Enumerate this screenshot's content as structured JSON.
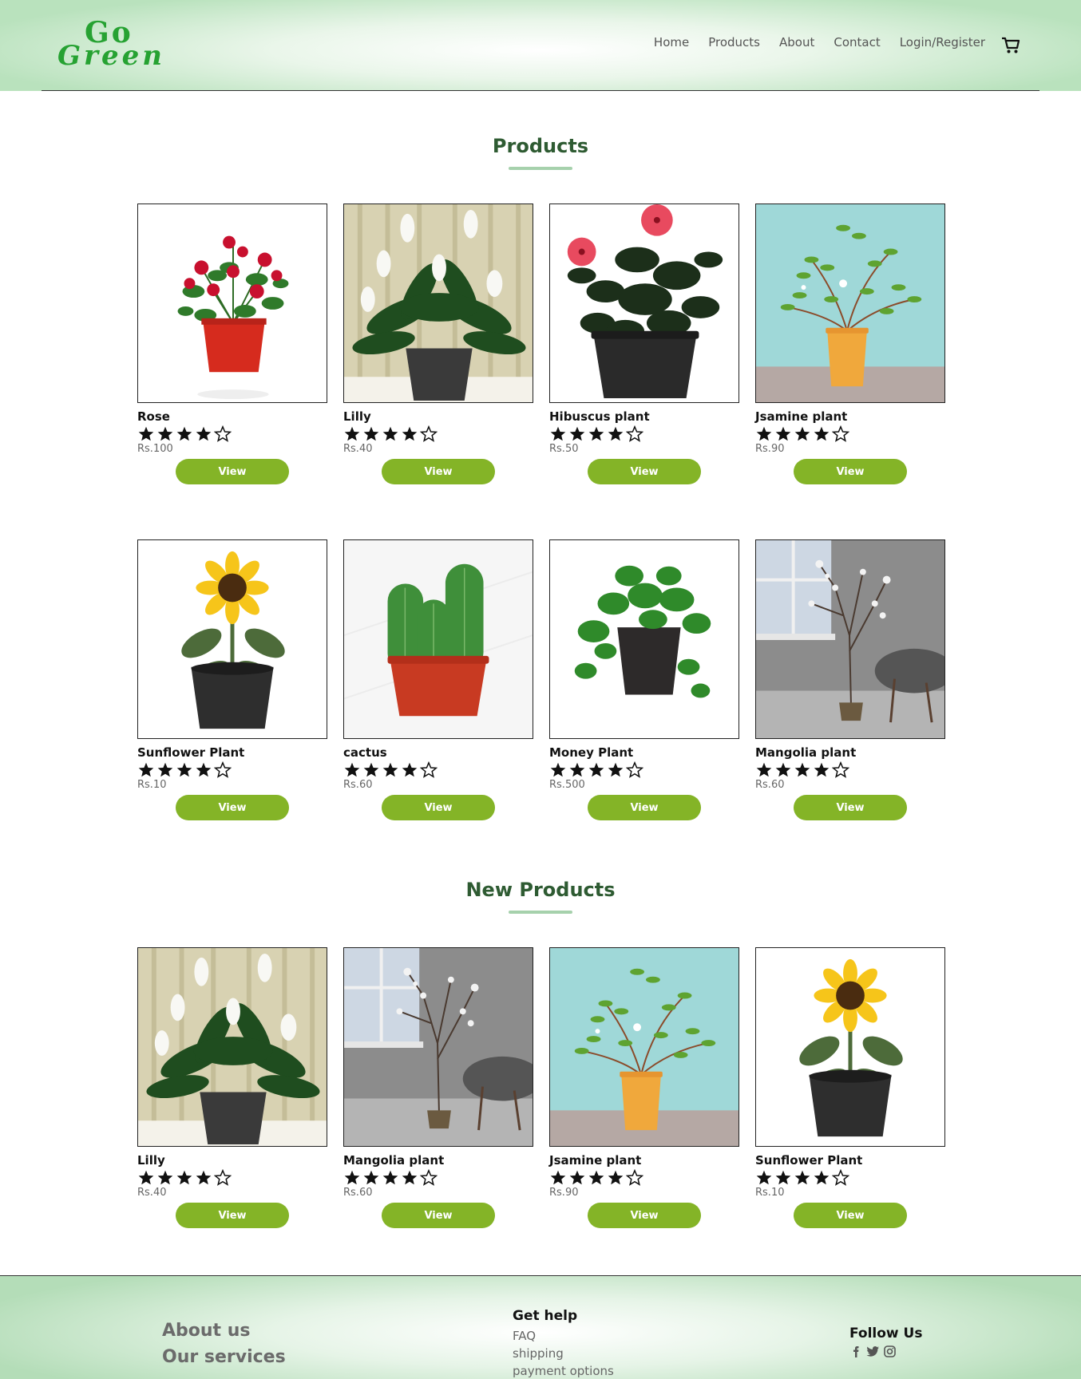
{
  "brand": {
    "line1": "Go",
    "line2": "Green"
  },
  "nav": {
    "items": [
      "Home",
      "Products",
      "About",
      "Contact",
      "Login/Register"
    ],
    "cart_icon": "cart-icon"
  },
  "sections": {
    "products_title": "Products",
    "new_products_title": "New Products"
  },
  "products": [
    {
      "name": "Rose",
      "price": "Rs.100",
      "rating": 4,
      "max_rating": 5,
      "view_label": "View",
      "image": "rose"
    },
    {
      "name": "Lilly",
      "price": "Rs.40",
      "rating": 4,
      "max_rating": 5,
      "view_label": "View",
      "image": "lilly"
    },
    {
      "name": "Hibuscus plant",
      "price": "Rs.50",
      "rating": 4,
      "max_rating": 5,
      "view_label": "View",
      "image": "hibiscus"
    },
    {
      "name": "Jsamine plant",
      "price": "Rs.90",
      "rating": 4,
      "max_rating": 5,
      "view_label": "View",
      "image": "jasmine"
    },
    {
      "name": "Sunflower Plant",
      "price": "Rs.10",
      "rating": 4,
      "max_rating": 5,
      "view_label": "View",
      "image": "sunflower"
    },
    {
      "name": "cactus",
      "price": "Rs.60",
      "rating": 4,
      "max_rating": 5,
      "view_label": "View",
      "image": "cactus"
    },
    {
      "name": "Money Plant",
      "price": "Rs.500",
      "rating": 4,
      "max_rating": 5,
      "view_label": "View",
      "image": "money"
    },
    {
      "name": "Mangolia plant",
      "price": "Rs.60",
      "rating": 4,
      "max_rating": 5,
      "view_label": "View",
      "image": "magnolia"
    }
  ],
  "new_products": [
    {
      "name": "Lilly",
      "price": "Rs.40",
      "rating": 4,
      "max_rating": 5,
      "view_label": "View",
      "image": "lilly"
    },
    {
      "name": "Mangolia plant",
      "price": "Rs.60",
      "rating": 4,
      "max_rating": 5,
      "view_label": "View",
      "image": "magnolia"
    },
    {
      "name": "Jsamine plant",
      "price": "Rs.90",
      "rating": 4,
      "max_rating": 5,
      "view_label": "View",
      "image": "jasmine"
    },
    {
      "name": "Sunflower Plant",
      "price": "Rs.10",
      "rating": 4,
      "max_rating": 5,
      "view_label": "View",
      "image": "sunflower"
    }
  ],
  "footer": {
    "about": "About us",
    "services": "Our services",
    "help_title": "Get help",
    "help_links": [
      "FAQ",
      "shipping",
      "payment options"
    ],
    "follow_title": "Follow Us",
    "social_icons": [
      "facebook-icon",
      "twitter-icon",
      "instagram-icon"
    ]
  },
  "colors": {
    "brand_green": "#26a232",
    "button_green": "#84b427",
    "title_green": "#2e5b32",
    "title_underline": "#a6d1ac"
  }
}
